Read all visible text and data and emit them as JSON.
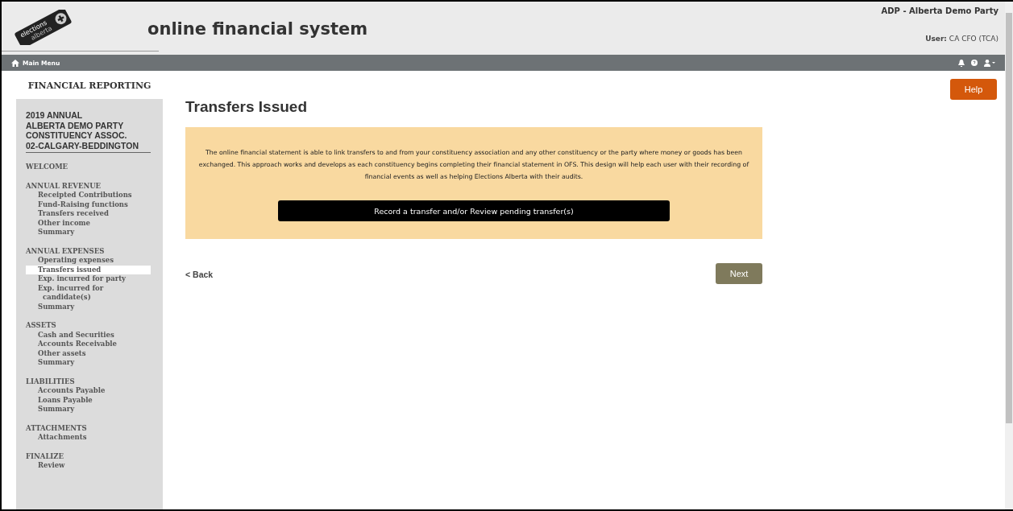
{
  "header": {
    "logo_text": [
      "elections",
      "alberta"
    ],
    "app_title": "online financial system",
    "organization": "ADP - Alberta Demo Party",
    "user_label": "User:",
    "user_name": "CA CFO (TCA)"
  },
  "navbar": {
    "main_menu": "Main Menu"
  },
  "sidebar": {
    "title": "FINANCIAL REPORTING",
    "context_lines": [
      "2019 ANNUAL",
      "ALBERTA DEMO PARTY",
      "CONSTITUENCY ASSOC.",
      "02-CALGARY-BEDDINGTON"
    ],
    "sections": [
      {
        "heading": "WELCOME"
      },
      {
        "heading": "ANNUAL REVENUE",
        "items": [
          {
            "label": "Receipted Contributions",
            "selected": false
          },
          {
            "label": "Fund-Raising functions",
            "selected": false
          },
          {
            "label": "Transfers received",
            "selected": false
          },
          {
            "label": "Other income",
            "selected": false
          },
          {
            "label": "Summary",
            "selected": false
          }
        ]
      },
      {
        "heading": "ANNUAL EXPENSES",
        "items": [
          {
            "label": "Operating expenses",
            "selected": false
          },
          {
            "label": "Transfers issued",
            "selected": true
          },
          {
            "label": "Exp. incurred for party",
            "selected": false
          },
          {
            "label": "Exp. incurred for candidate(s)",
            "selected": false
          },
          {
            "label": "Summary",
            "selected": false
          }
        ]
      },
      {
        "heading": "ASSETS",
        "items": [
          {
            "label": "Cash and Securities",
            "selected": false
          },
          {
            "label": "Accounts Receivable",
            "selected": false
          },
          {
            "label": "Other assets",
            "selected": false
          },
          {
            "label": "Summary",
            "selected": false
          }
        ]
      },
      {
        "heading": "LIABILITIES",
        "items": [
          {
            "label": "Accounts Payable",
            "selected": false
          },
          {
            "label": "Loans Payable",
            "selected": false
          },
          {
            "label": "Summary",
            "selected": false
          }
        ]
      },
      {
        "heading": "ATTACHMENTS",
        "items": [
          {
            "label": "Attachments",
            "selected": false
          }
        ]
      },
      {
        "heading": "FINALIZE",
        "items": [
          {
            "label": "Review",
            "selected": false
          }
        ]
      }
    ]
  },
  "main": {
    "help_button": "Help",
    "title": "Transfers Issued",
    "info_text": "The online financial statement is able to link transfers to and from your constituency association and any other constituency or the party where money or goods has been exchanged. This approach works and develops as each constituency begins completing their financial statement in OFS. This design will help each user with their recording of financial events as well as helping Elections Alberta with their audits.",
    "action_button": "Record a transfer and/or Review pending transfer(s)",
    "back_link": "< Back",
    "next_button": "Next"
  }
}
